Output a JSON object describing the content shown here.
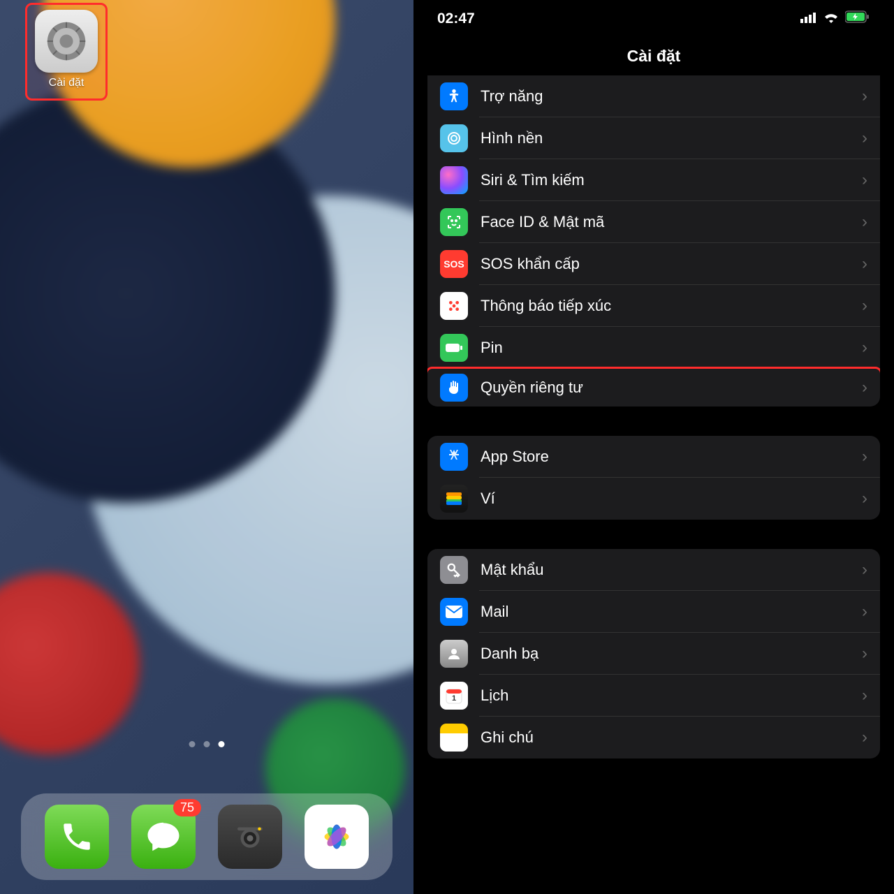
{
  "homescreen": {
    "settings_app_label": "Cài đặt",
    "messages_badge": "75"
  },
  "statusbar": {
    "time": "02:47"
  },
  "header": {
    "title": "Cài đặt"
  },
  "group1": [
    {
      "label": "Trợ năng",
      "icon": "accessibility",
      "bg": "bg-blue"
    },
    {
      "label": "Hình nền",
      "icon": "wallpaper",
      "bg": "bg-cyan"
    },
    {
      "label": "Siri & Tìm kiếm",
      "icon": "siri",
      "bg": "siri-icon"
    },
    {
      "label": "Face ID & Mật mã",
      "icon": "faceid",
      "bg": "bg-green"
    },
    {
      "label": "SOS khẩn cấp",
      "icon": "sos",
      "bg": "bg-red"
    },
    {
      "label": "Thông báo tiếp xúc",
      "icon": "exposure",
      "bg": "bg-white"
    },
    {
      "label": "Pin",
      "icon": "battery",
      "bg": "bg-green"
    },
    {
      "label": "Quyền riêng tư",
      "icon": "privacy",
      "bg": "bg-blue",
      "highlighted": true
    }
  ],
  "group2": [
    {
      "label": "App Store",
      "icon": "appstore",
      "bg": "bg-blue"
    },
    {
      "label": "Ví",
      "icon": "wallet",
      "bg": "wallet-icon"
    }
  ],
  "group3": [
    {
      "label": "Mật khẩu",
      "icon": "passwords",
      "bg": "bg-gray"
    },
    {
      "label": "Mail",
      "icon": "mail",
      "bg": "bg-blue"
    },
    {
      "label": "Danh bạ",
      "icon": "contacts",
      "bg": "bg-gray"
    },
    {
      "label": "Lịch",
      "icon": "calendar",
      "bg": "bg-white"
    },
    {
      "label": "Ghi chú",
      "icon": "notes",
      "bg": "bg-yellow"
    }
  ]
}
